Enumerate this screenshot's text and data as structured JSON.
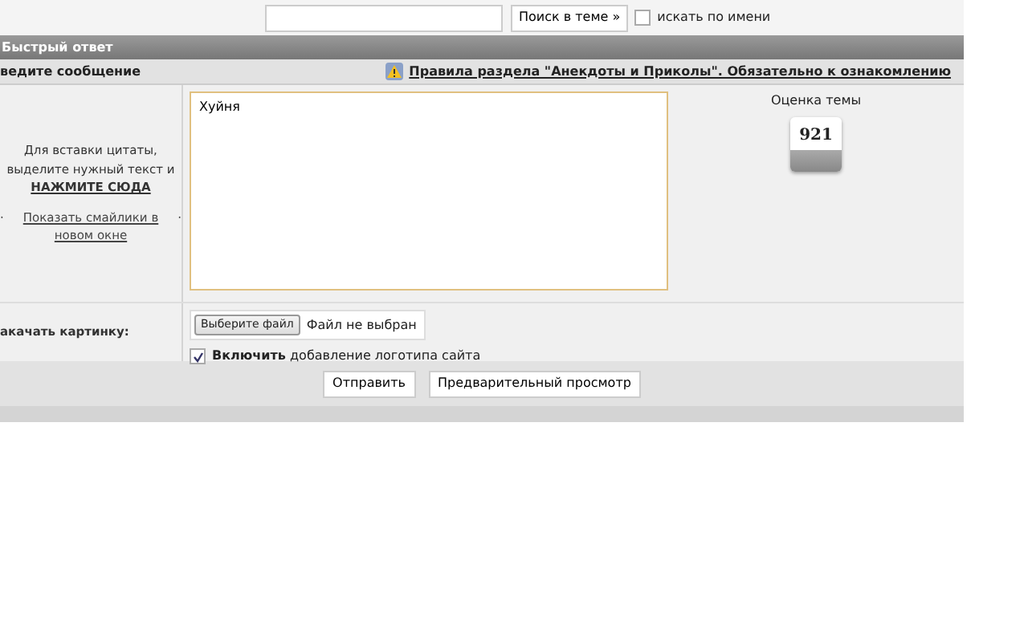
{
  "search": {
    "button": "Поиск в теме »",
    "by_name": {
      "label": "искать по имени",
      "checked": false
    }
  },
  "header": {
    "title": "Быстрый ответ"
  },
  "subheader": {
    "label": "ведите сообщение",
    "rules_link": "Правила раздела \"Анекдоты и Приколы\". Обязательно к ознакомлению"
  },
  "sidebar": {
    "hint": "Для вставки цитаты, выделите нужный текст и",
    "hint_action": "НАЖМИТЕ СЮДА",
    "smilies_link": "Показать смайлики в новом окне",
    "bullet_before": "·",
    "bullet_after": "·"
  },
  "message": {
    "value": "Хуйня"
  },
  "rating": {
    "label": "Оценка темы",
    "value": "921"
  },
  "upload": {
    "label": "акачать картинку:",
    "file_button": "Выберите файл",
    "file_status": "Файл не выбран",
    "logo": {
      "bold": "Включить",
      "text": "добавление логотипа сайта",
      "checked": true
    }
  },
  "buttons": [
    "Отправить",
    "Предварительный просмотр"
  ]
}
